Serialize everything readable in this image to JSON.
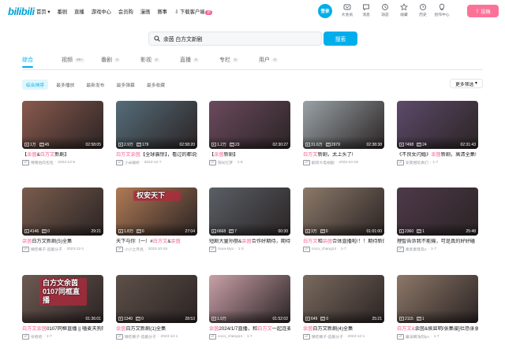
{
  "header": {
    "logo": "bilibili",
    "nav": [
      "首页",
      "番剧",
      "直播",
      "游戏中心",
      "会员购",
      "漫画",
      "赛事",
      "下载客户端"
    ],
    "nav_badge": "新",
    "login_label": "登录",
    "right_icons": [
      {
        "label": "大会员",
        "icon": "vip-icon"
      },
      {
        "label": "消息",
        "icon": "message-icon"
      },
      {
        "label": "动态",
        "icon": "dynamic-icon"
      },
      {
        "label": "收藏",
        "icon": "star-icon"
      },
      {
        "label": "历史",
        "icon": "history-icon"
      },
      {
        "label": "创作中心",
        "icon": "bulb-icon"
      }
    ],
    "upload_label": "投稿"
  },
  "search": {
    "query": "余茵 白方文新剧",
    "button": "搜索"
  },
  "tabs": [
    {
      "label": "综合",
      "count": ""
    },
    {
      "label": "视频",
      "count": "99+"
    },
    {
      "label": "番剧",
      "count": "0"
    },
    {
      "label": "影视",
      "count": "0"
    },
    {
      "label": "直播",
      "count": "0"
    },
    {
      "label": "专栏",
      "count": "0"
    },
    {
      "label": "用户",
      "count": "0"
    }
  ],
  "filters": [
    "综合排序",
    "最多播放",
    "最新发布",
    "最多弹幕",
    "最多收藏"
  ],
  "more_filters": "更多筛选",
  "videos": [
    {
      "views": "1万",
      "danmaku": "45",
      "duration": "02:58:05",
      "title_pre": "【",
      "title_hl1": "余茵",
      "title_mid": "&",
      "title_hl2": "白方文",
      "title_post": "新剧】",
      "uploader": "嘿嘿怕肉包包",
      "date": "2023-12-5",
      "bg": "#8a5a4e",
      "overlay": ""
    },
    {
      "views": "2.9万",
      "danmaku": "179",
      "duration": "02:58:20",
      "title_pre": "",
      "title_hl1": "白方文",
      "title_mid": "",
      "title_hl2": "余茵",
      "title_post": "【全球震惊】，看过的都说好，上头推荐!",
      "uploader": "小米解析",
      "date": "2023-12-7",
      "bg": "#556d7a",
      "overlay": ""
    },
    {
      "views": "1.2万",
      "danmaku": "23",
      "duration": "02:30:27",
      "title_pre": "【",
      "title_hl1": "余茵",
      "title_mid": "",
      "title_hl2": "",
      "title_post": "新剧】",
      "uploader": "阳光忆梦",
      "date": "1-6",
      "bg": "#6b4a5e",
      "overlay": ""
    },
    {
      "views": "31.6万",
      "danmaku": "2979",
      "duration": "02:38:38",
      "title_pre": "",
      "title_hl1": "白方文",
      "title_mid": "新剧，太上头了!",
      "title_hl2": "",
      "title_post": "",
      "uploader": "剧场大电视剧",
      "date": "2023-10-19",
      "bg": "#9aa3a8",
      "overlay": ""
    },
    {
      "views": "7498",
      "danmaku": "24",
      "duration": "02:31:43",
      "title_pre": "《不良女闪婚》",
      "title_hl1": "余茵",
      "title_mid": "新剧，高清全集!",
      "title_hl2": "",
      "title_post": "",
      "uploader": "安夏相玩真们",
      "date": "1-7",
      "bg": "#5d4a6a",
      "overlay": ""
    },
    {
      "views": "4146",
      "danmaku": "0",
      "duration": "29:21",
      "title_pre": "",
      "title_hl1": "余茵",
      "title_mid": "",
      "title_hl2": "",
      "title_post": "白方文新剧(5)全集",
      "uploader": "懒吃椰子-追剧分子",
      "date": "2023-12-1",
      "bg": "#7a5d4e",
      "overlay": ""
    },
    {
      "views": "1.8万",
      "danmaku": "6",
      "duration": "27:04",
      "title_pre": "天下与你（一）#",
      "title_hl1": "白方文",
      "title_mid": "&",
      "title_hl2": "余茵",
      "title_post": "",
      "uploader": "小小之月亮",
      "date": "2023-10-15",
      "bg": "#b07a55",
      "overlay": "权安天下"
    },
    {
      "views": "6668",
      "danmaku": "7",
      "duration": "00:30",
      "title_pre": "短剧大量孙丽&",
      "title_hl1": "余茵",
      "title_mid": "合作好期待，期待新的大戏吗",
      "title_hl2": "",
      "title_post": "",
      "uploader": "Sara-kiyu",
      "date": "1-3",
      "bg": "#5a6066",
      "overlay": ""
    },
    {
      "views": "3万",
      "danmaku": "0",
      "duration": "01:01:00",
      "title_pre": "",
      "title_hl1": "白方文",
      "title_mid": "和",
      "title_hl2": "余茵",
      "title_post": "合体直播啦!！！期待新的戏中，期待。2024/1/7",
      "uploader": "coco_chang14",
      "date": "1-7",
      "bg": "#8c7a6a",
      "overlay": ""
    },
    {
      "views": "2360",
      "danmaku": "1",
      "duration": "25:48",
      "title_pre": "理智告诉我不能输，可是真的好好磕",
      "title_hl1": "",
      "title_mid": "",
      "title_hl2": "",
      "title_post": "",
      "uploader": "素武素我及o",
      "date": "1-7",
      "bg": "#4e3a4a",
      "overlay": ""
    },
    {
      "views": "",
      "danmaku": "",
      "duration": "01:36:01",
      "title_pre": "",
      "title_hl1": "白方文余茵",
      "title_mid": "0107同框直播 || 嗑麦天狗同框，又来了",
      "title_hl2": "",
      "title_post": "",
      "uploader": "朵哈哈",
      "date": "1-7",
      "bg": "#6e5a52",
      "overlay": "白方文余茵 0107同框直播"
    },
    {
      "views": "1340",
      "danmaku": "0",
      "duration": "28:53",
      "title_pre": "",
      "title_hl1": "余茵",
      "title_mid": "白方文新剧(1)全集",
      "title_hl2": "",
      "title_post": "",
      "uploader": "懒吃椰子-追剧分子",
      "date": "2023-12-1",
      "bg": "#5e5048",
      "overlay": ""
    },
    {
      "views": "1.9万",
      "danmaku": "",
      "duration": "01:52:02",
      "title_pre": "",
      "title_hl1": "余茵",
      "title_mid": "2024/1/7直播，和",
      "title_hl2": "白方文",
      "title_post": "一起连麦，太快乐了简直!",
      "uploader": "coco_chang14",
      "date": "1-7",
      "bg": "#c9a0a8",
      "overlay": ""
    },
    {
      "views": "649",
      "danmaku": "0",
      "duration": "25:21",
      "title_pre": "",
      "title_hl1": "余茵",
      "title_mid": "白方文新剧(4)全集",
      "title_hl2": "",
      "title_post": "",
      "uploader": "懒吃椰子-追剧分子",
      "date": "2023-12-1",
      "bg": "#7a6a5e",
      "overlay": ""
    },
    {
      "views": "2115",
      "danmaku": "1",
      "duration": "",
      "title_pre": "",
      "title_hl1": "白方文&",
      "title_mid": "余茵&",
      "title_hl2": "",
      "title_post": "侯显明/张集璇]社恐张张",
      "uploader": "暮溪朝浅的lyn",
      "date": "1-7",
      "bg": "#8d7868",
      "overlay": ""
    }
  ]
}
